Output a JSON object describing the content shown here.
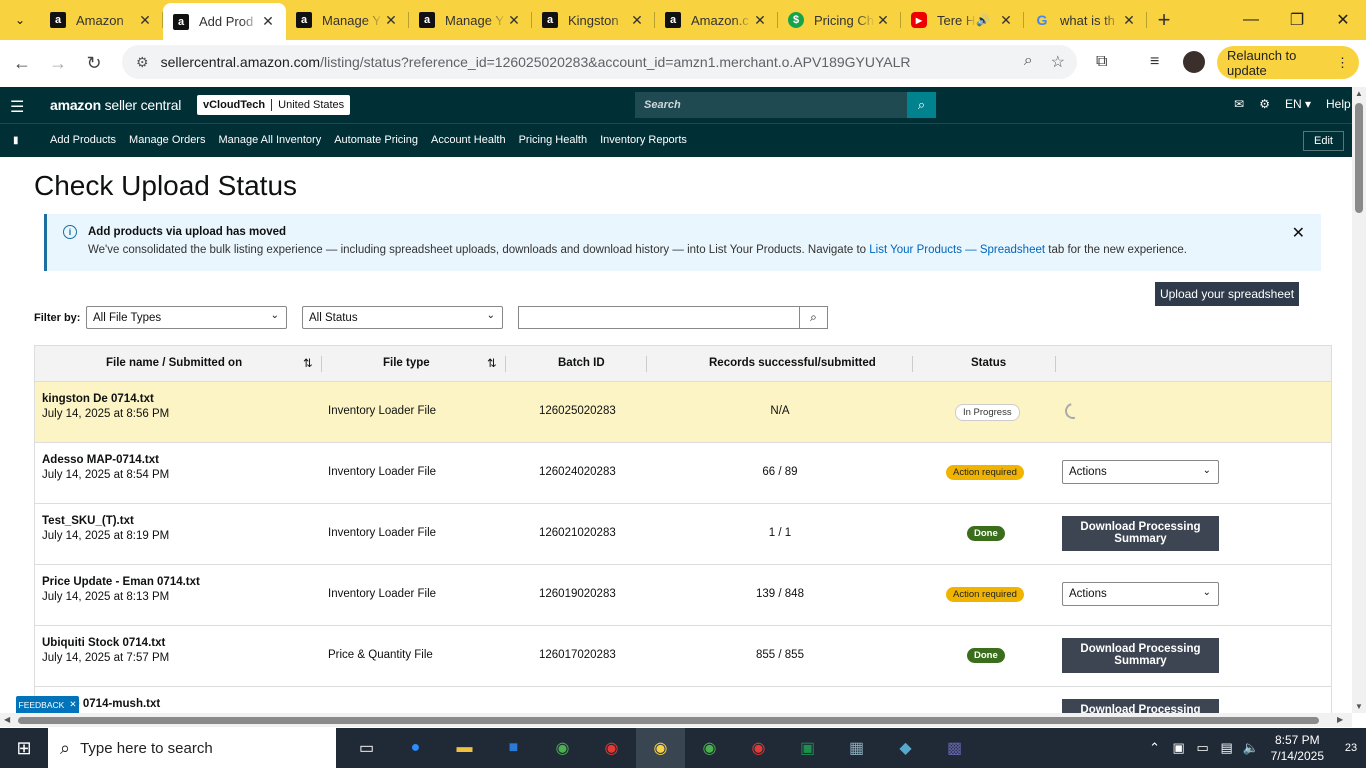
{
  "browser": {
    "tabs": [
      {
        "title": "Amazon",
        "favicon": "amazon-icon",
        "active": false
      },
      {
        "title": "Add Prod",
        "favicon": "amazon-icon",
        "active": true
      },
      {
        "title": "Manage Y",
        "favicon": "amazon-icon",
        "active": false
      },
      {
        "title": "Manage Y",
        "favicon": "amazon-icon",
        "active": false
      },
      {
        "title": "Kingston",
        "favicon": "amazon-icon",
        "active": false
      },
      {
        "title": "Amazon.c",
        "favicon": "amazon-icon",
        "active": false
      },
      {
        "title": "Pricing Ch",
        "favicon": "pricing-icon",
        "active": false
      },
      {
        "title": "Tere H",
        "favicon": "youtube-icon",
        "active": false
      },
      {
        "title": "what is th",
        "favicon": "google-icon",
        "active": false
      }
    ],
    "url_domain": "sellercentral.amazon.com",
    "url_path": "/listing/status?reference_id=126025020283&account_id=amzn1.merchant.o.APV189GYUYALR",
    "relaunch_label": "Relaunch to update"
  },
  "header": {
    "logo_bold": "amazon",
    "logo_rest": " seller central",
    "account_name": "vCloudTech",
    "account_region": "United States",
    "search_placeholder": "Search",
    "language": "EN",
    "help": "Help"
  },
  "nav": {
    "links": [
      "Add Products",
      "Manage Orders",
      "Manage All Inventory",
      "Automate Pricing",
      "Account Health",
      "Pricing Health",
      "Inventory Reports"
    ],
    "edit_label": "Edit"
  },
  "page": {
    "title": "Check Upload Status"
  },
  "banner": {
    "heading": "Add products via upload has moved",
    "body_prefix": "We've consolidated the bulk listing experience — including spreadsheet uploads, downloads and download history — into List Your Products. Navigate to ",
    "link_text": "List Your Products — Spreadsheet",
    "body_suffix": " tab for the new experience."
  },
  "toolbar": {
    "upload_label": "Upload your spreadsheet",
    "filter_label": "Filter by:",
    "file_type_value": "All File Types",
    "status_value": "All Status",
    "search_value": ""
  },
  "table": {
    "headers": [
      "File name / Submitted on",
      "File type",
      "Batch ID",
      "Records successful/submitted",
      "Status"
    ],
    "rows": [
      {
        "file": "kingston De 0714.txt",
        "date": "July 14, 2025 at 8:56 PM",
        "type": "Inventory Loader File",
        "batch": "126025020283",
        "records": "N/A",
        "status": "In Progress",
        "status_kind": "prog",
        "action": "spinner"
      },
      {
        "file": "Adesso MAP-0714.txt",
        "date": "July 14, 2025 at 8:54 PM",
        "type": "Inventory Loader File",
        "batch": "126024020283",
        "records": "66 / 89",
        "status": "Action required",
        "status_kind": "req",
        "action": "Actions"
      },
      {
        "file": "Test_SKU_(T).txt",
        "date": "July 14, 2025 at 8:19 PM",
        "type": "Inventory Loader File",
        "batch": "126021020283",
        "records": "1 / 1",
        "status": "Done",
        "status_kind": "done",
        "action": "Download Processing Summary"
      },
      {
        "file": "Price Update - Eman 0714.txt",
        "date": "July 14, 2025 at 8:13 PM",
        "type": "Inventory Loader File",
        "batch": "126019020283",
        "records": "139 / 848",
        "status": "Action required",
        "status_kind": "req",
        "action": "Actions"
      },
      {
        "file": "Ubiquiti Stock 0714.txt",
        "date": "July 14, 2025 at 7:57 PM",
        "type": "Price & Quantity File",
        "batch": "126017020283",
        "records": "855 / 855",
        "status": "Done",
        "status_kind": "done",
        "action": "Download Processing Summary"
      },
      {
        "file": "update 0714-mush.txt",
        "date": "",
        "type": "",
        "batch": "",
        "records": "",
        "status": "",
        "status_kind": "done",
        "action": "Download Processing"
      }
    ]
  },
  "feedback_label": "FEEDBACK",
  "taskbar": {
    "search_placeholder": "Type here to search",
    "time": "8:57 PM",
    "date": "7/14/2025",
    "notification_count": "23"
  }
}
